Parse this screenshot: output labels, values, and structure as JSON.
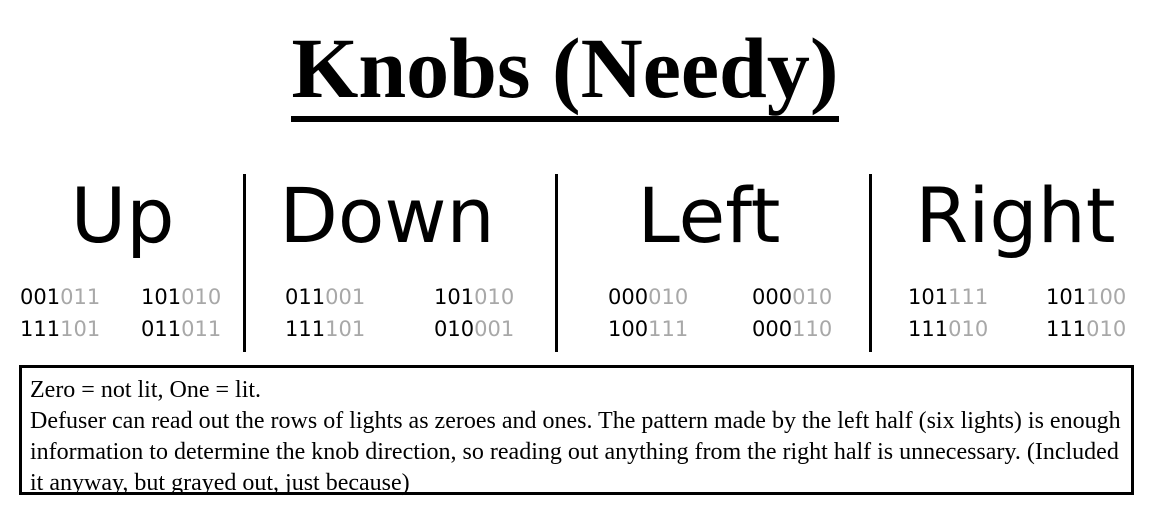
{
  "title": "Knobs (Needy)",
  "colors": {
    "lit": "#000000",
    "unlit": "#a8a8a8"
  },
  "directions": [
    {
      "label": "Up",
      "patterns": [
        {
          "left": "001",
          "right": "011"
        },
        {
          "left": "111",
          "right": "101"
        },
        {
          "left": "101",
          "right": "010"
        },
        {
          "left": "011",
          "right": "011"
        }
      ]
    },
    {
      "label": "Down",
      "patterns": [
        {
          "left": "011",
          "right": "001"
        },
        {
          "left": "111",
          "right": "101"
        },
        {
          "left": "101",
          "right": "010"
        },
        {
          "left": "010",
          "right": "001"
        }
      ]
    },
    {
      "label": "Left",
      "patterns": [
        {
          "left": "000",
          "right": "010"
        },
        {
          "left": "100",
          "right": "111"
        },
        {
          "left": "000",
          "right": "010"
        },
        {
          "left": "000",
          "right": "110"
        }
      ]
    },
    {
      "label": "Right",
      "patterns": [
        {
          "left": "101",
          "right": "111"
        },
        {
          "left": "111",
          "right": "010"
        },
        {
          "left": "101",
          "right": "100"
        },
        {
          "left": "111",
          "right": "010"
        }
      ]
    }
  ],
  "info": {
    "line1": "Zero = not lit, One = lit.",
    "line2": "Defuser can read out the rows of lights as zeroes and ones. The pattern made by the left half (six lights) is enough information to determine the knob direction, so reading out anything from the right half is unnecessary. (Included it anyway, but grayed out, just because)"
  }
}
